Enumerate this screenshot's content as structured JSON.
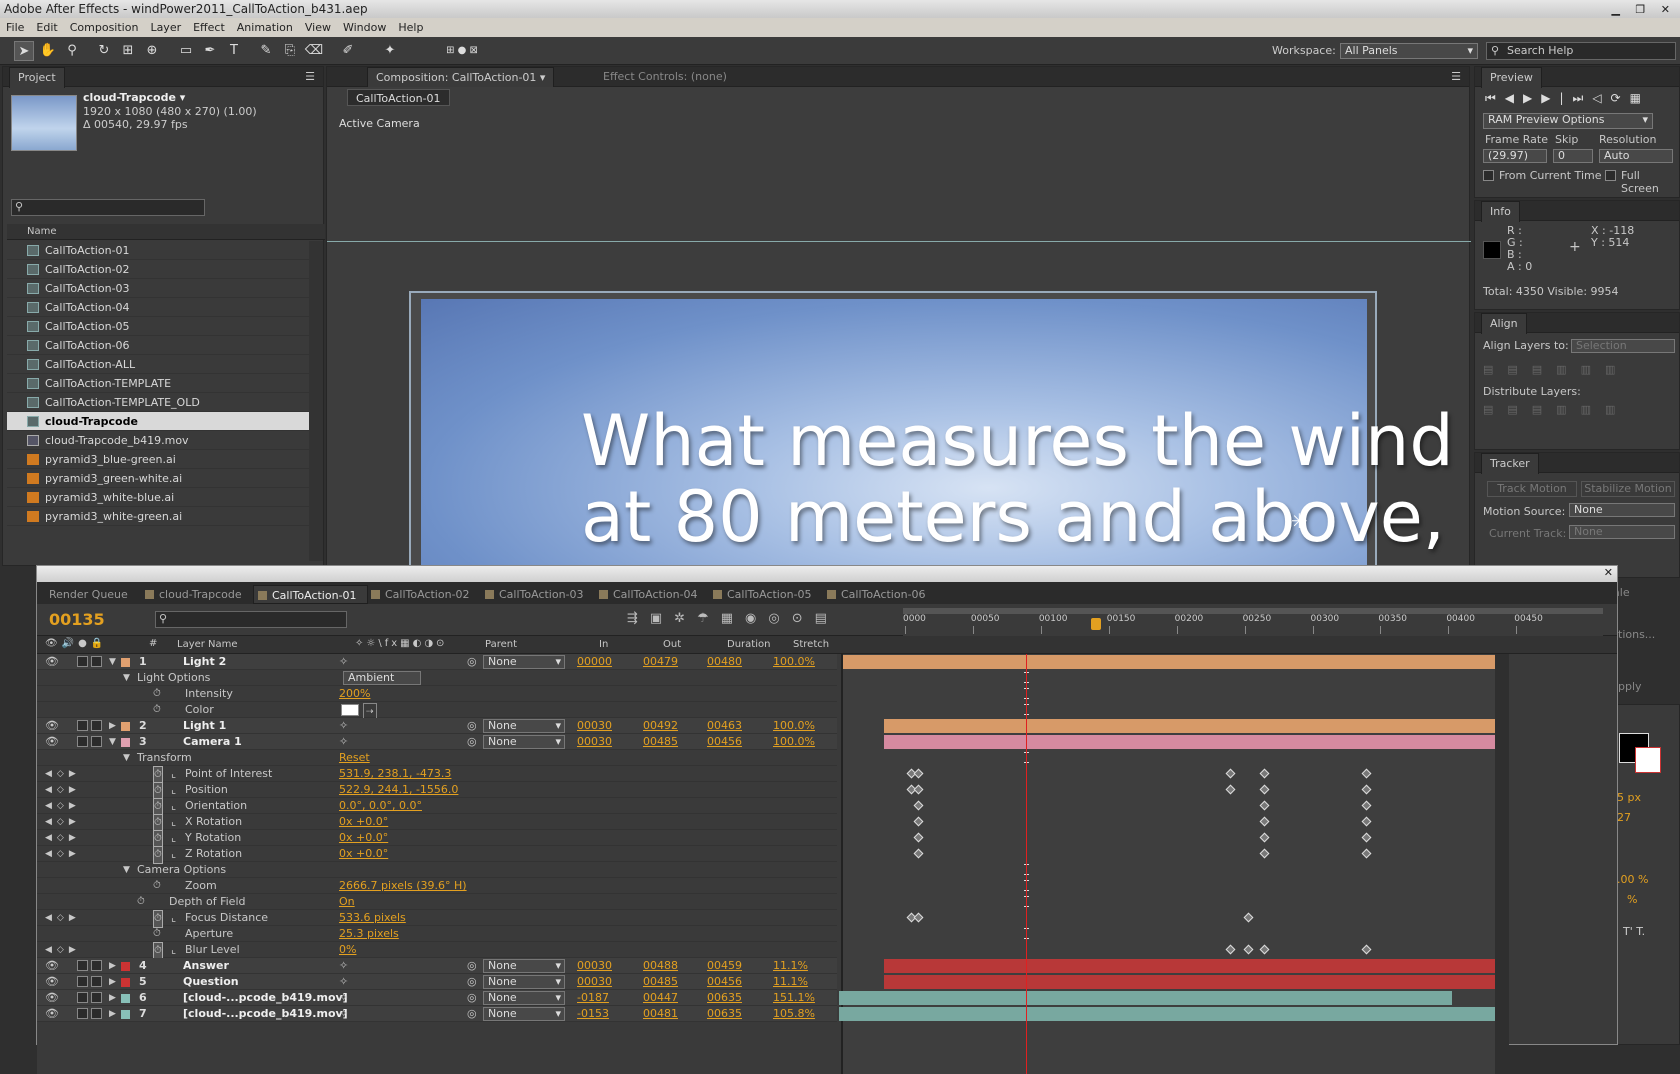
{
  "app": {
    "title": "Adobe After Effects - windPower2011_CallToAction_b431.aep"
  },
  "menu": [
    "File",
    "Edit",
    "Composition",
    "Layer",
    "Effect",
    "Animation",
    "View",
    "Window",
    "Help"
  ],
  "toolbar": {
    "workspace_label": "Workspace:",
    "workspace_value": "All Panels",
    "search_placeholder": "Search Help"
  },
  "project": {
    "tab": "Project",
    "selected_name": "cloud-Trapcode ▾",
    "info_line1": "1920 x 1080  (480 x 270) (1.00)",
    "info_line2": "Δ 00540, 29.97 fps",
    "col_name": "Name",
    "items": [
      {
        "name": "CallToAction-01",
        "type": "comp"
      },
      {
        "name": "CallToAction-02",
        "type": "comp"
      },
      {
        "name": "CallToAction-03",
        "type": "comp"
      },
      {
        "name": "CallToAction-04",
        "type": "comp"
      },
      {
        "name": "CallToAction-05",
        "type": "comp"
      },
      {
        "name": "CallToAction-06",
        "type": "comp"
      },
      {
        "name": "CallToAction-ALL",
        "type": "comp"
      },
      {
        "name": "CallToAction-TEMPLATE",
        "type": "comp"
      },
      {
        "name": "CallToAction-TEMPLATE_OLD",
        "type": "comp"
      },
      {
        "name": "cloud-Trapcode",
        "type": "comp"
      },
      {
        "name": "cloud-Trapcode_b419.mov",
        "type": "mov"
      },
      {
        "name": "pyramid3_blue-green.ai",
        "type": "ai"
      },
      {
        "name": "pyramid3_green-white.ai",
        "type": "ai"
      },
      {
        "name": "pyramid3_white-blue.ai",
        "type": "ai"
      },
      {
        "name": "pyramid3_white-green.ai",
        "type": "ai"
      }
    ]
  },
  "composition": {
    "tab": "Composition: CallToAction-01",
    "effect_tab": "Effect Controls: (none)",
    "subtab": "CallToAction-01",
    "camera_label": "Active Camera",
    "text_line1": "What measures the wind",
    "text_line2": "at 80 meters and above,"
  },
  "preview": {
    "tab": "Preview",
    "ram_options": "RAM Preview Options",
    "frame_rate_label": "Frame Rate",
    "skip_label": "Skip",
    "resolution_label": "Resolution",
    "frame_rate": "(29.97)",
    "skip": "0",
    "resolution": "Auto",
    "from_current": "From Current Time",
    "full_screen": "Full Screen"
  },
  "info": {
    "tab": "Info",
    "r": "R :",
    "g": "G :",
    "b": "B :",
    "a": "A : 0",
    "x": "X : -118",
    "y": "Y : 514",
    "totals": "Total: 4350   Visible: 9954"
  },
  "align": {
    "tab": "Align",
    "layers_to": "Align Layers to:",
    "selection": "Selection",
    "distribute": "Distribute Layers:"
  },
  "tracker": {
    "tab": "Tracker",
    "track_motion": "Track Motion",
    "stabilize": "Stabilize Motion",
    "motion_source_label": "Motion Source:",
    "motion_source": "None",
    "current_track_label": "Current Track:",
    "current_track": "None"
  },
  "right_partial": {
    "scale": "Scale",
    "options": "tions...",
    "apply": "pply",
    "px": "5 px",
    "n27": "27",
    "pct1": ".00 %",
    "pct2": "%"
  },
  "timeline": {
    "tabs": [
      "Render Queue",
      "cloud-Trapcode",
      "CallToAction-01",
      "CallToAction-02",
      "CallToAction-03",
      "CallToAction-04",
      "CallToAction-05",
      "CallToAction-06"
    ],
    "timecode": "00135",
    "ruler": [
      "0000",
      "00050",
      "00100",
      "00150",
      "00200",
      "00250",
      "00300",
      "00350",
      "00400",
      "00450"
    ],
    "headers": {
      "layer_name": "Layer Name",
      "parent": "Parent",
      "in": "In",
      "out": "Out",
      "duration": "Duration",
      "stretch": "Stretch",
      "num": "#"
    },
    "rows": [
      {
        "kind": "layer",
        "num": "1",
        "name": "Light 2",
        "color": "#e0a070",
        "parent": "None",
        "in": "00000",
        "out": "00479",
        "dur": "00480",
        "stretch": "100.0%",
        "expanded": true
      },
      {
        "kind": "group",
        "indent": 1,
        "name": "Light Options",
        "value": "Ambient"
      },
      {
        "kind": "prop",
        "indent": 2,
        "name": "Intensity",
        "value": "200%"
      },
      {
        "kind": "prop",
        "indent": 2,
        "name": "Color",
        "value": ""
      },
      {
        "kind": "layer",
        "num": "2",
        "name": "Light 1",
        "color": "#e0a070",
        "parent": "None",
        "in": "00030",
        "out": "00492",
        "dur": "00463",
        "stretch": "100.0%",
        "expanded": false
      },
      {
        "kind": "layer",
        "num": "3",
        "name": "Camera 1",
        "color": "#e0a0b0",
        "parent": "None",
        "in": "00030",
        "out": "00485",
        "dur": "00456",
        "stretch": "100.0%",
        "expanded": true
      },
      {
        "kind": "group",
        "indent": 1,
        "name": "Transform",
        "value": "Reset"
      },
      {
        "kind": "prop",
        "indent": 2,
        "name": "Point of Interest",
        "value": "531.9, 238.1, -473.3"
      },
      {
        "kind": "prop",
        "indent": 2,
        "name": "Position",
        "value": "522.9, 244.1, -1556.0"
      },
      {
        "kind": "prop",
        "indent": 2,
        "name": "Orientation",
        "value": "0.0°, 0.0°, 0.0°"
      },
      {
        "kind": "prop",
        "indent": 2,
        "name": "X Rotation",
        "value": "0x +0.0°"
      },
      {
        "kind": "prop",
        "indent": 2,
        "name": "Y Rotation",
        "value": "0x +0.0°"
      },
      {
        "kind": "prop",
        "indent": 2,
        "name": "Z Rotation",
        "value": "0x +0.0°"
      },
      {
        "kind": "group",
        "indent": 1,
        "name": "Camera Options",
        "value": ""
      },
      {
        "kind": "prop",
        "indent": 2,
        "name": "Zoom",
        "value": "2666.7 pixels (39.6° H)"
      },
      {
        "kind": "prop",
        "indent": 1,
        "name": "Depth of Field",
        "value": "On"
      },
      {
        "kind": "prop",
        "indent": 2,
        "name": "Focus Distance",
        "value": "533.6 pixels"
      },
      {
        "kind": "prop",
        "indent": 2,
        "name": "Aperture",
        "value": "25.3 pixels"
      },
      {
        "kind": "prop",
        "indent": 2,
        "name": "Blur Level",
        "value": "0%"
      },
      {
        "kind": "layer",
        "num": "4",
        "name": "Answer",
        "color": "#cc3333",
        "parent": "None",
        "in": "00030",
        "out": "00488",
        "dur": "00459",
        "stretch": "11.1%",
        "expanded": false
      },
      {
        "kind": "layer",
        "num": "5",
        "name": "Question",
        "color": "#cc3333",
        "parent": "None",
        "in": "00030",
        "out": "00485",
        "dur": "00456",
        "stretch": "11.1%",
        "expanded": false
      },
      {
        "kind": "layer",
        "num": "6",
        "name": "[cloud-...pcode_b419.mov]",
        "color": "#88c0b8",
        "parent": "None",
        "in": "-0187",
        "out": "00447",
        "dur": "00635",
        "stretch": "151.1%",
        "expanded": false
      },
      {
        "kind": "layer",
        "num": "7",
        "name": "[cloud-...pcode_b419.mov]",
        "color": "#88c0b8",
        "parent": "None",
        "in": "-0153",
        "out": "00481",
        "dur": "00635",
        "stretch": "105.8%",
        "expanded": false
      }
    ]
  },
  "colors": {
    "accent_orange": "#e3a020",
    "light_bar": "#d79a68",
    "camera_bar": "#d58aa0",
    "text_bar": "#b83838",
    "footage_bar": "#78a8a0",
    "playhead": "#e02020"
  }
}
